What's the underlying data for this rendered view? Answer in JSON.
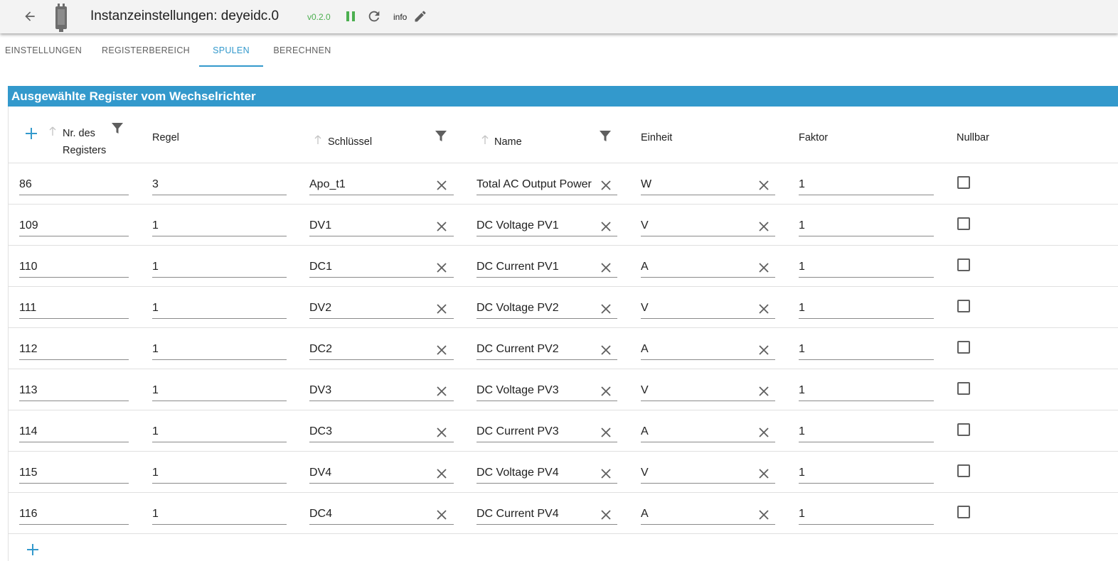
{
  "header": {
    "title": "Instanzeinstellungen: deyeidc.0",
    "version": "v0.2.0",
    "info": "info"
  },
  "tabs": [
    {
      "label": "EINSTELLUNGEN",
      "active": false
    },
    {
      "label": "REGISTERBEREICH",
      "active": false
    },
    {
      "label": "SPULEN",
      "active": true
    },
    {
      "label": "BERECHNEN",
      "active": false
    }
  ],
  "section": {
    "title": "Ausgewählte Register vom Wechselrichter"
  },
  "table": {
    "columns": {
      "register_line1": "Nr. des",
      "register_line2": "Registers",
      "rule": "Regel",
      "key": "Schlüssel",
      "name": "Name",
      "unit": "Einheit",
      "factor": "Faktor",
      "nullable": "Nullbar"
    },
    "rows": [
      {
        "register": "86",
        "rule": "3",
        "key": "Apo_t1",
        "name": "Total AC Output Power",
        "unit": "W",
        "factor": "1",
        "nullable": false
      },
      {
        "register": "109",
        "rule": "1",
        "key": "DV1",
        "name": "DC Voltage PV1",
        "unit": "V",
        "factor": "1",
        "nullable": false
      },
      {
        "register": "110",
        "rule": "1",
        "key": "DC1",
        "name": "DC Current PV1",
        "unit": "A",
        "factor": "1",
        "nullable": false
      },
      {
        "register": "111",
        "rule": "1",
        "key": "DV2",
        "name": "DC Voltage PV2",
        "unit": "V",
        "factor": "1",
        "nullable": false
      },
      {
        "register": "112",
        "rule": "1",
        "key": "DC2",
        "name": "DC Current PV2",
        "unit": "A",
        "factor": "1",
        "nullable": false
      },
      {
        "register": "113",
        "rule": "1",
        "key": "DV3",
        "name": "DC Voltage PV3",
        "unit": "V",
        "factor": "1",
        "nullable": false
      },
      {
        "register": "114",
        "rule": "1",
        "key": "DC3",
        "name": "DC Current PV3",
        "unit": "A",
        "factor": "1",
        "nullable": false
      },
      {
        "register": "115",
        "rule": "1",
        "key": "DV4",
        "name": "DC Voltage PV4",
        "unit": "V",
        "factor": "1",
        "nullable": false
      },
      {
        "register": "116",
        "rule": "1",
        "key": "DC4",
        "name": "DC Current PV4",
        "unit": "A",
        "factor": "1",
        "nullable": false
      }
    ]
  },
  "colors": {
    "accent": "#3399cc",
    "version": "#4caf50"
  }
}
